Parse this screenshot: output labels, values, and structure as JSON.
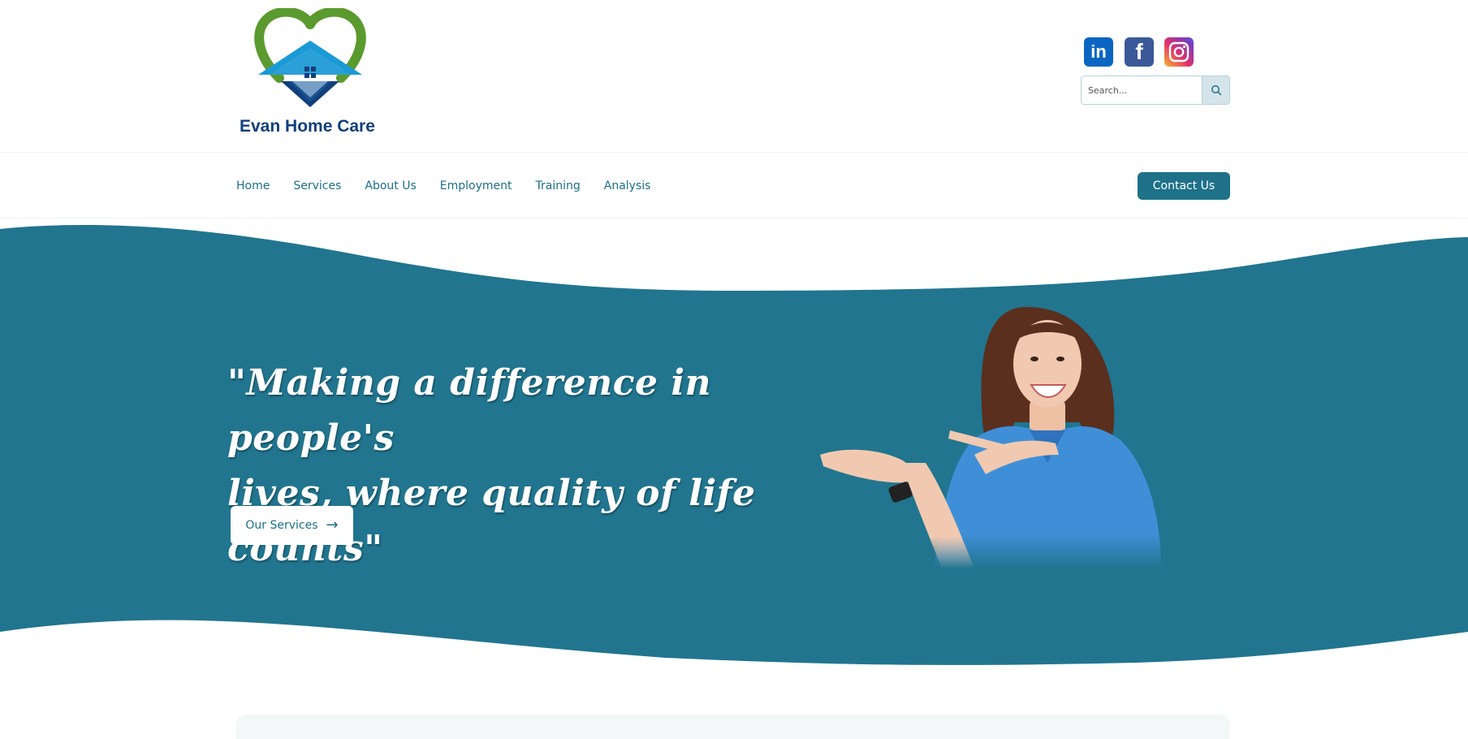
{
  "brand": {
    "name": "Evan Home Care",
    "colors": {
      "primary": "#1e7189",
      "heart": "#5a9a2e",
      "roof": "#1a9ad6",
      "text_dark": "#123f7c"
    }
  },
  "header": {
    "social": [
      {
        "name": "linkedin",
        "icon": "linkedin-icon",
        "glyph": "in"
      },
      {
        "name": "facebook",
        "icon": "facebook-icon",
        "glyph": "f"
      },
      {
        "name": "instagram",
        "icon": "instagram-icon"
      }
    ],
    "search": {
      "placeholder": "Search...",
      "value": "",
      "icon": "search-icon"
    }
  },
  "nav": {
    "items": [
      {
        "label": "Home"
      },
      {
        "label": "Services"
      },
      {
        "label": "About Us"
      },
      {
        "label": "Employment"
      },
      {
        "label": "Training"
      },
      {
        "label": "Analysis"
      }
    ],
    "cta_label": "Contact Us"
  },
  "hero": {
    "quote_line1": "\"Making a difference in people's",
    "quote_line2": "lives, where quality of life counts\"",
    "button_label": "Our Services",
    "button_icon": "arrow-right-icon",
    "background": "#21758f"
  }
}
